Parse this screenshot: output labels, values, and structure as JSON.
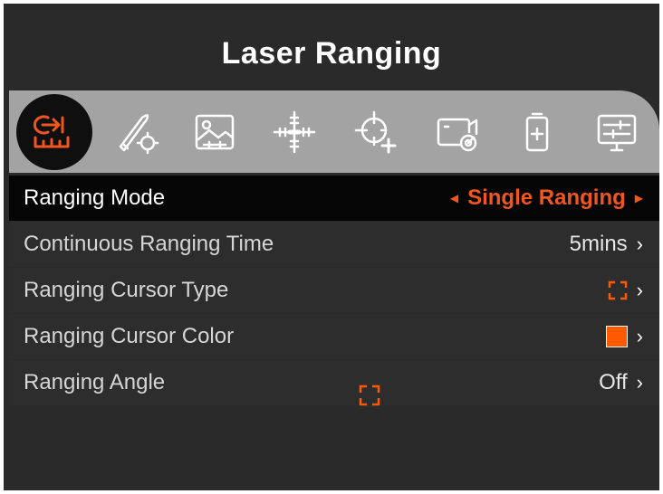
{
  "title": "Laser Ranging",
  "tabs": [
    {
      "icon": "laser-ranging-icon",
      "active": true
    },
    {
      "icon": "ballistic-icon",
      "active": false
    },
    {
      "icon": "image-settings-icon",
      "active": false
    },
    {
      "icon": "reticle-icon",
      "active": false
    },
    {
      "icon": "zeroing-icon",
      "active": false
    },
    {
      "icon": "camera-record-icon",
      "active": false
    },
    {
      "icon": "battery-icon",
      "active": false
    },
    {
      "icon": "display-settings-icon",
      "active": false
    }
  ],
  "menu": {
    "ranging_mode": {
      "label": "Ranging Mode",
      "value": "Single Ranging"
    },
    "continuous_time": {
      "label": "Continuous Ranging Time",
      "value": "5mins"
    },
    "cursor_type": {
      "label": "Ranging Cursor Type"
    },
    "cursor_color": {
      "label": "Ranging Cursor Color",
      "color": "#ff5a00"
    },
    "ranging_angle": {
      "label": "Ranging Angle",
      "value": "Off"
    }
  },
  "colors": {
    "accent": "#f0561e",
    "active_row": "#050505",
    "tabbar": "#a3a3a3"
  }
}
